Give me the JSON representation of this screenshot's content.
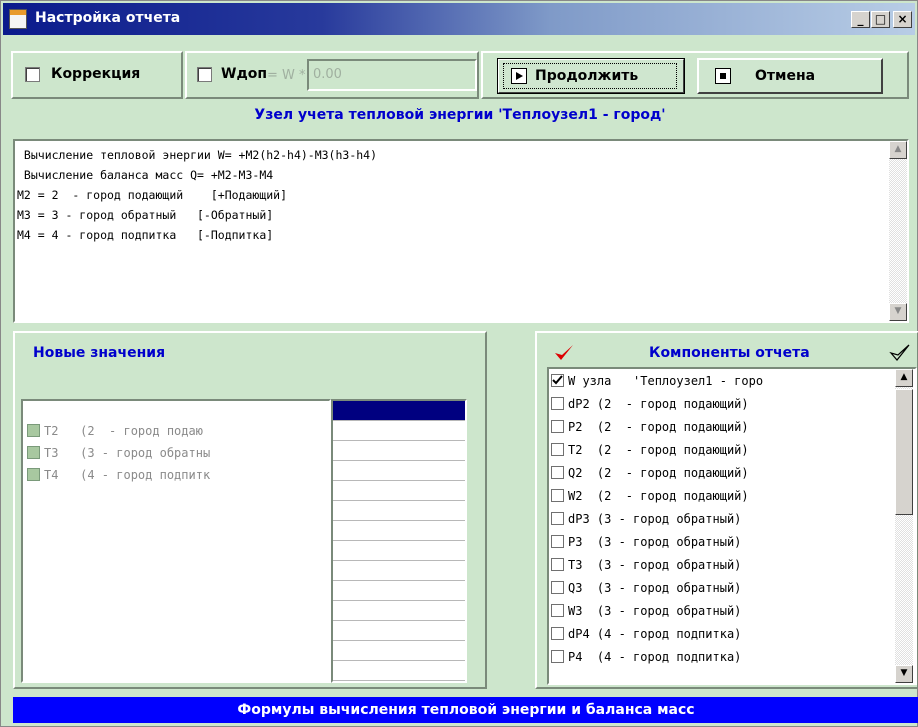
{
  "window": {
    "title": "Настройка отчета",
    "controls": {
      "minimize": "_",
      "maximize": "□",
      "close": "×"
    }
  },
  "toolbar": {
    "correction_label": "Коррекция",
    "wdop_label": "Wдоп",
    "w_formula": "= W *",
    "w_value": "0.00",
    "continue_label": "Продолжить",
    "cancel_label": "Отмена"
  },
  "node_title": "Узел учета тепловой энергии 'Теплоузел1 - город'",
  "formulas": [
    " Вычисление тепловой энергии W= +M2(h2-h4)-M3(h3-h4)",
    " Вычисление баланса масс Q= +M2-M3-M4",
    "M2 = 2  - город подающий    [+Подающий]",
    "M3 = 3 - город обратный   [-Обратный]",
    "M4 = 4 - город подпитка   [-Подпитка]"
  ],
  "new_values": {
    "heading": "Новые значения",
    "items": [
      {
        "label": "T2   (2  - город подаю"
      },
      {
        "label": "T3   (3 - город обратны"
      },
      {
        "label": "T4   (4 - город подпитк"
      }
    ],
    "value_cells": 15
  },
  "components": {
    "heading": "Компоненты отчета",
    "items": [
      {
        "label": "W узла   'Теплоузел1 - горо",
        "checked": true
      },
      {
        "label": "dP2 (2  - город подающий)",
        "checked": false
      },
      {
        "label": "P2  (2  - город подающий)",
        "checked": false
      },
      {
        "label": "T2  (2  - город подающий)",
        "checked": false
      },
      {
        "label": "Q2  (2  - город подающий)",
        "checked": false
      },
      {
        "label": "W2  (2  - город подающий)",
        "checked": false
      },
      {
        "label": "dP3 (3 - город обратный)",
        "checked": false
      },
      {
        "label": "P3  (3 - город обратный)",
        "checked": false
      },
      {
        "label": "T3  (3 - город обратный)",
        "checked": false
      },
      {
        "label": "Q3  (3 - город обратный)",
        "checked": false
      },
      {
        "label": "W3  (3 - город обратный)",
        "checked": false
      },
      {
        "label": "dP4 (4 - город подпитка)",
        "checked": false
      },
      {
        "label": "P4  (4 - город подпитка)",
        "checked": false
      }
    ]
  },
  "status": "Формулы вычисления тепловой энергии и баланса масс",
  "colors": {
    "accent": "#0000cc",
    "status_bg": "#0000ff",
    "window_bg": "#cde6cc",
    "selected_cell": "#000080",
    "check_red": "#dd0000"
  }
}
